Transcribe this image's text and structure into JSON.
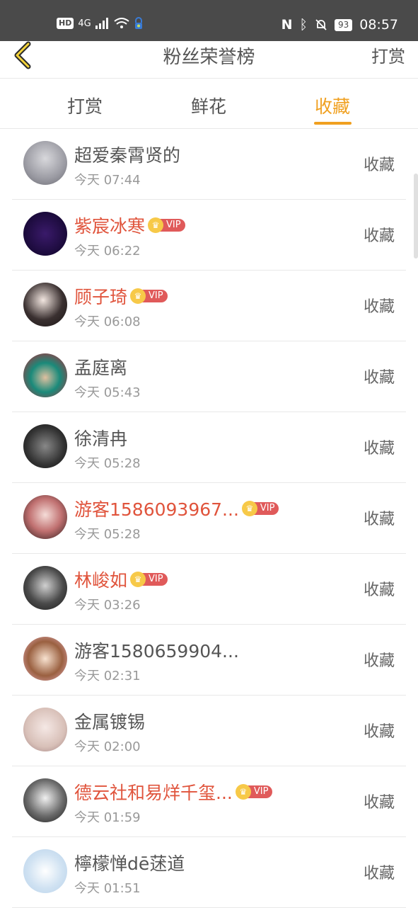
{
  "status_bar": {
    "network": "4G",
    "battery": "93",
    "time": "08:57"
  },
  "nav": {
    "title": "粉丝荣誉榜",
    "right_action": "打赏"
  },
  "tabs": [
    "打赏",
    "鲜花",
    "收藏"
  ],
  "active_tab": "收藏",
  "vip_label": "VIP",
  "list": [
    {
      "name": "超爱秦霄贤的",
      "time": "今天 07:44",
      "vip": false,
      "action": "收藏"
    },
    {
      "name": "紫宸冰寒",
      "time": "今天 06:22",
      "vip": true,
      "action": "收藏"
    },
    {
      "name": "顾子琦",
      "time": "今天 06:08",
      "vip": true,
      "action": "收藏"
    },
    {
      "name": "孟庭离",
      "time": "今天 05:43",
      "vip": false,
      "action": "收藏"
    },
    {
      "name": "徐清冉",
      "time": "今天 05:28",
      "vip": false,
      "action": "收藏"
    },
    {
      "name": "游客1586093967...",
      "time": "今天 05:28",
      "vip": true,
      "action": "收藏"
    },
    {
      "name": "林峻如",
      "time": "今天 03:26",
      "vip": true,
      "action": "收藏"
    },
    {
      "name": "游客1580659904...",
      "time": "今天 02:31",
      "vip": false,
      "action": "收藏"
    },
    {
      "name": "金属镀锡",
      "time": "今天 02:00",
      "vip": false,
      "action": "收藏"
    },
    {
      "name": "德云社和易烊千玺...",
      "time": "今天 01:59",
      "vip": true,
      "action": "收藏"
    },
    {
      "name": "檸檬惮dē蒁道",
      "time": "今天 01:51",
      "vip": false,
      "action": "收藏"
    }
  ],
  "colors": {
    "accent": "#f0a020",
    "vip_name": "#e0543c",
    "vip_badge": "#e05a5a",
    "crown": "#f7c948"
  }
}
